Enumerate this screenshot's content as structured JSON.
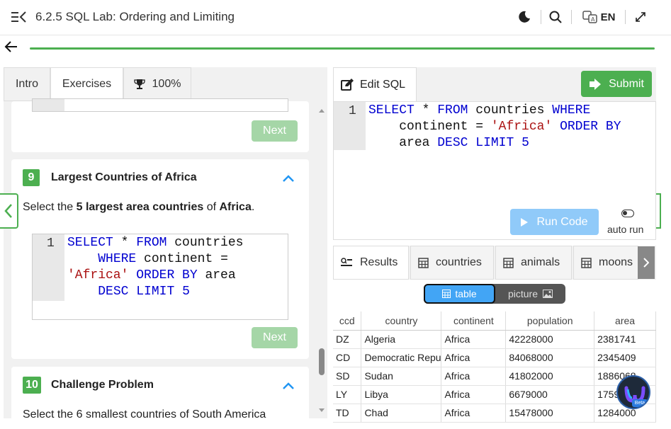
{
  "header": {
    "title": "6.2.5 SQL Lab: Ordering and Limiting",
    "lang_label": "EN"
  },
  "left_tabs": [
    {
      "label": "Intro"
    },
    {
      "label": "Exercises"
    },
    {
      "label": "100%"
    }
  ],
  "exercises": {
    "next_label": "Next",
    "ex9": {
      "number": "9",
      "title": "Largest Countries of Africa",
      "desc_parts": [
        "Select the ",
        "5 largest area countries",
        " of ",
        "Africa",
        "."
      ],
      "line": "1"
    },
    "ex10": {
      "number": "10",
      "title": "Challenge Problem",
      "desc": "Select the 6 smallest countries of South America"
    }
  },
  "editor": {
    "tab_label": "Edit SQL",
    "submit_label": "Submit",
    "run_label": "Run Code",
    "auto_run_label": "auto run",
    "line": "1"
  },
  "code_tokens": {
    "select": "SELECT",
    "star": " * ",
    "from": "FROM",
    "countries": " countries ",
    "where": "WHERE",
    "continent": "continent = ",
    "africa": "'Africa'",
    "order_by": "ORDER BY",
    "area": "area ",
    "area_sp": " area",
    "desc": "DESC",
    "limit": "LIMIT",
    "five": "5",
    "left_l1_countries": " countries",
    "left_l2_continent": "continent ="
  },
  "result_tabs": [
    {
      "label": "Results"
    },
    {
      "label": "countries"
    },
    {
      "label": "animals"
    },
    {
      "label": "moons"
    }
  ],
  "view_toggle": {
    "table_label": "table",
    "picture_label": "picture"
  },
  "table": {
    "columns": [
      "ccd",
      "country",
      "continent",
      "population",
      "area"
    ],
    "rows": [
      [
        "DZ",
        "Algeria",
        "Africa",
        "42228000",
        "2381741"
      ],
      [
        "CD",
        "Democratic Republic of the Congo",
        "Africa",
        "84068000",
        "2345409"
      ],
      [
        "SD",
        "Sudan",
        "Africa",
        "41802000",
        "1886068"
      ],
      [
        "LY",
        "Libya",
        "Africa",
        "6679000",
        "1759540"
      ],
      [
        "TD",
        "Chad",
        "Africa",
        "15478000",
        "1284000"
      ]
    ]
  },
  "badge": {
    "label": "Beta"
  },
  "colors": {
    "accent": "#4caf50",
    "keyword": "#0000d0",
    "string": "#aa1111",
    "run_button": "#90caf9",
    "toggle_active": "#42a5f5"
  }
}
